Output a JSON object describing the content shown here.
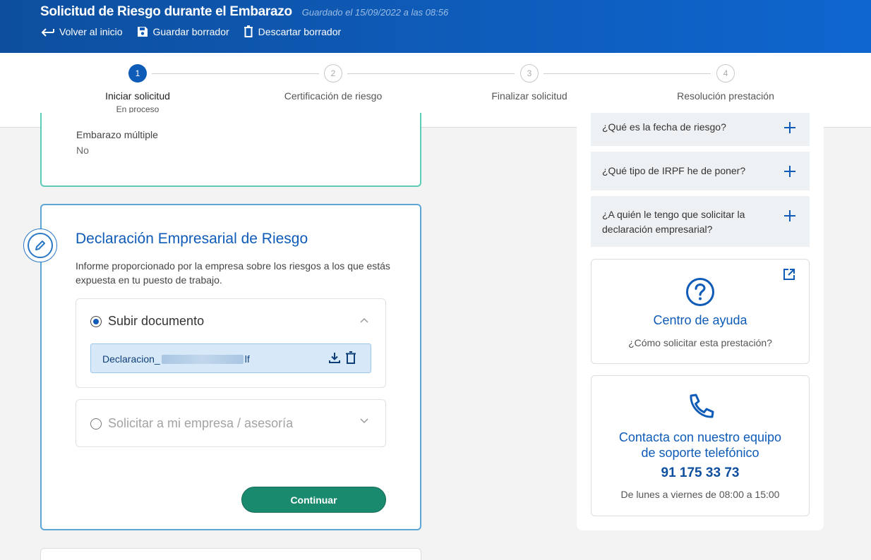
{
  "header": {
    "title": "Solicitud de Riesgo durante el Embarazo",
    "saved": "Guardado el 15/09/2022 a las 08:56",
    "actions": {
      "back": "Volver al inicio",
      "save": "Guardar borrador",
      "discard": "Descartar borrador"
    }
  },
  "stepper": {
    "steps": [
      {
        "number": "1",
        "label": "Iniciar solicitud",
        "status": "En proceso"
      },
      {
        "number": "2",
        "label": "Certificación de riesgo"
      },
      {
        "number": "3",
        "label": "Finalizar solicitud"
      },
      {
        "number": "4",
        "label": "Resolución prestación"
      }
    ]
  },
  "previous_section": {
    "field_label": "Embarazo múltiple",
    "field_value": "No"
  },
  "declaration": {
    "title": "Declaración Empresarial de Riesgo",
    "description": "Informe proporcionado por la empresa sobre los riesgos a los que estás expuesta en tu puesto de trabajo.",
    "option_upload": "Subir documento",
    "file_prefix": "Declaracion_",
    "file_suffix": "lf",
    "option_request": "Solicitar a mi empresa / asesoría",
    "continue_label": "Continuar"
  },
  "faq": [
    {
      "question": "¿Qué es la fecha de riesgo?"
    },
    {
      "question": "¿Qué tipo de IRPF he de poner?"
    },
    {
      "question": "¿A quién le tengo que solicitar la declaración empresarial?"
    }
  ],
  "help_center": {
    "title": "Centro de ayuda",
    "subtitle": "¿Cómo solicitar esta prestación?"
  },
  "phone_support": {
    "title": "Contacta con nuestro equipo de soporte telefónico",
    "number": "91 175 33 73",
    "hours": "De lunes a viernes de 08:00 a 15:00"
  },
  "colors": {
    "brand_blue": "#0e5bb8",
    "header_dark": "#0d4f9e",
    "accent_teal": "#5ccbb8",
    "continue_green": "#1a8a6e"
  },
  "icons": {
    "back": "arrow-left-icon",
    "save": "floppy-disk-icon",
    "discard": "trash-icon",
    "edit": "pencil-circle-icon",
    "chevron_up": "chevron-up-icon",
    "chevron_down": "chevron-down-icon",
    "download": "download-icon",
    "delete": "trash-icon",
    "external": "external-link-icon",
    "help": "question-circle-icon",
    "phone": "phone-icon",
    "plus": "plus-icon"
  }
}
